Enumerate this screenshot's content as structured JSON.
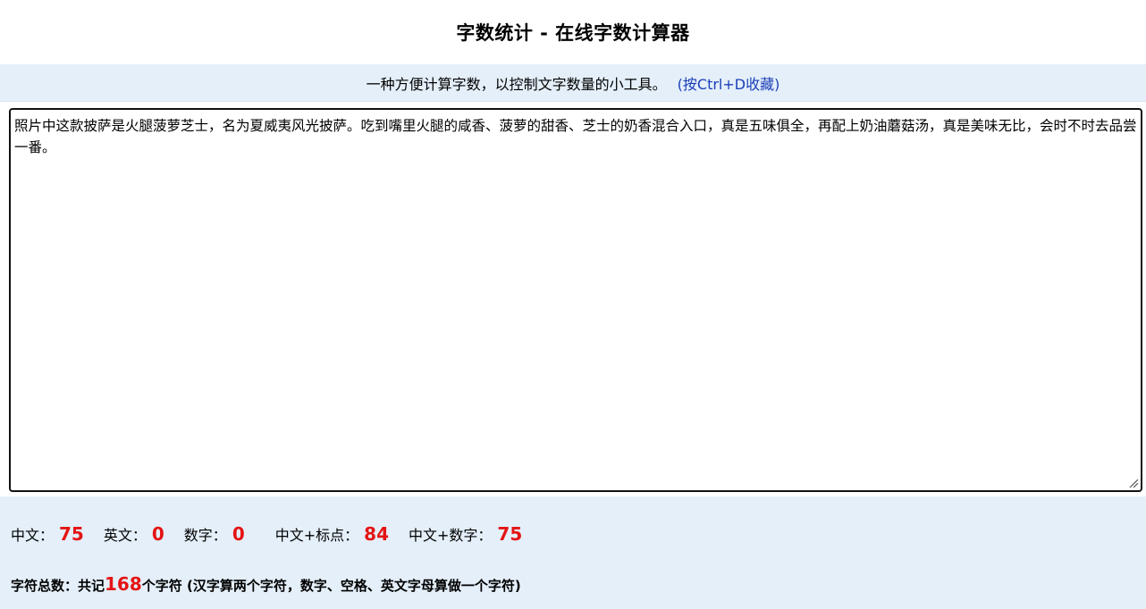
{
  "header": {
    "title": "字数统计 - 在线字数计算器"
  },
  "subbar": {
    "tagline": "一种方便计算字数，以控制文字数量的小工具。",
    "bookmark": "(按Ctrl+D收藏)"
  },
  "editor": {
    "value": "照片中这款披萨是火腿菠萝芝士，名为夏威夷风光披萨。吃到嘴里火腿的咸香、菠萝的甜香、芝士的奶香混合入口，真是五味俱全，再配上奶油蘑菇汤，真是美味无比，会时不时去品尝一番。"
  },
  "stats": {
    "chinese_label": "中文：",
    "chinese_value": "75",
    "english_label": "英文：",
    "english_value": "0",
    "digits_label": "数字：",
    "digits_value": "0",
    "chinese_punct_label": "中文+标点：",
    "chinese_punct_value": "84",
    "chinese_digits_label": "中文+数字：",
    "chinese_digits_value": "75"
  },
  "total": {
    "prefix": "字符总数：共记",
    "value": "168",
    "suffix": "个字符 (汉字算两个字符，数字、空格、英文字母算做一个字符)"
  },
  "colors": {
    "accent_red": "#e41414",
    "bar_bg": "#e4eff9",
    "link_blue": "#1a3eb8"
  }
}
